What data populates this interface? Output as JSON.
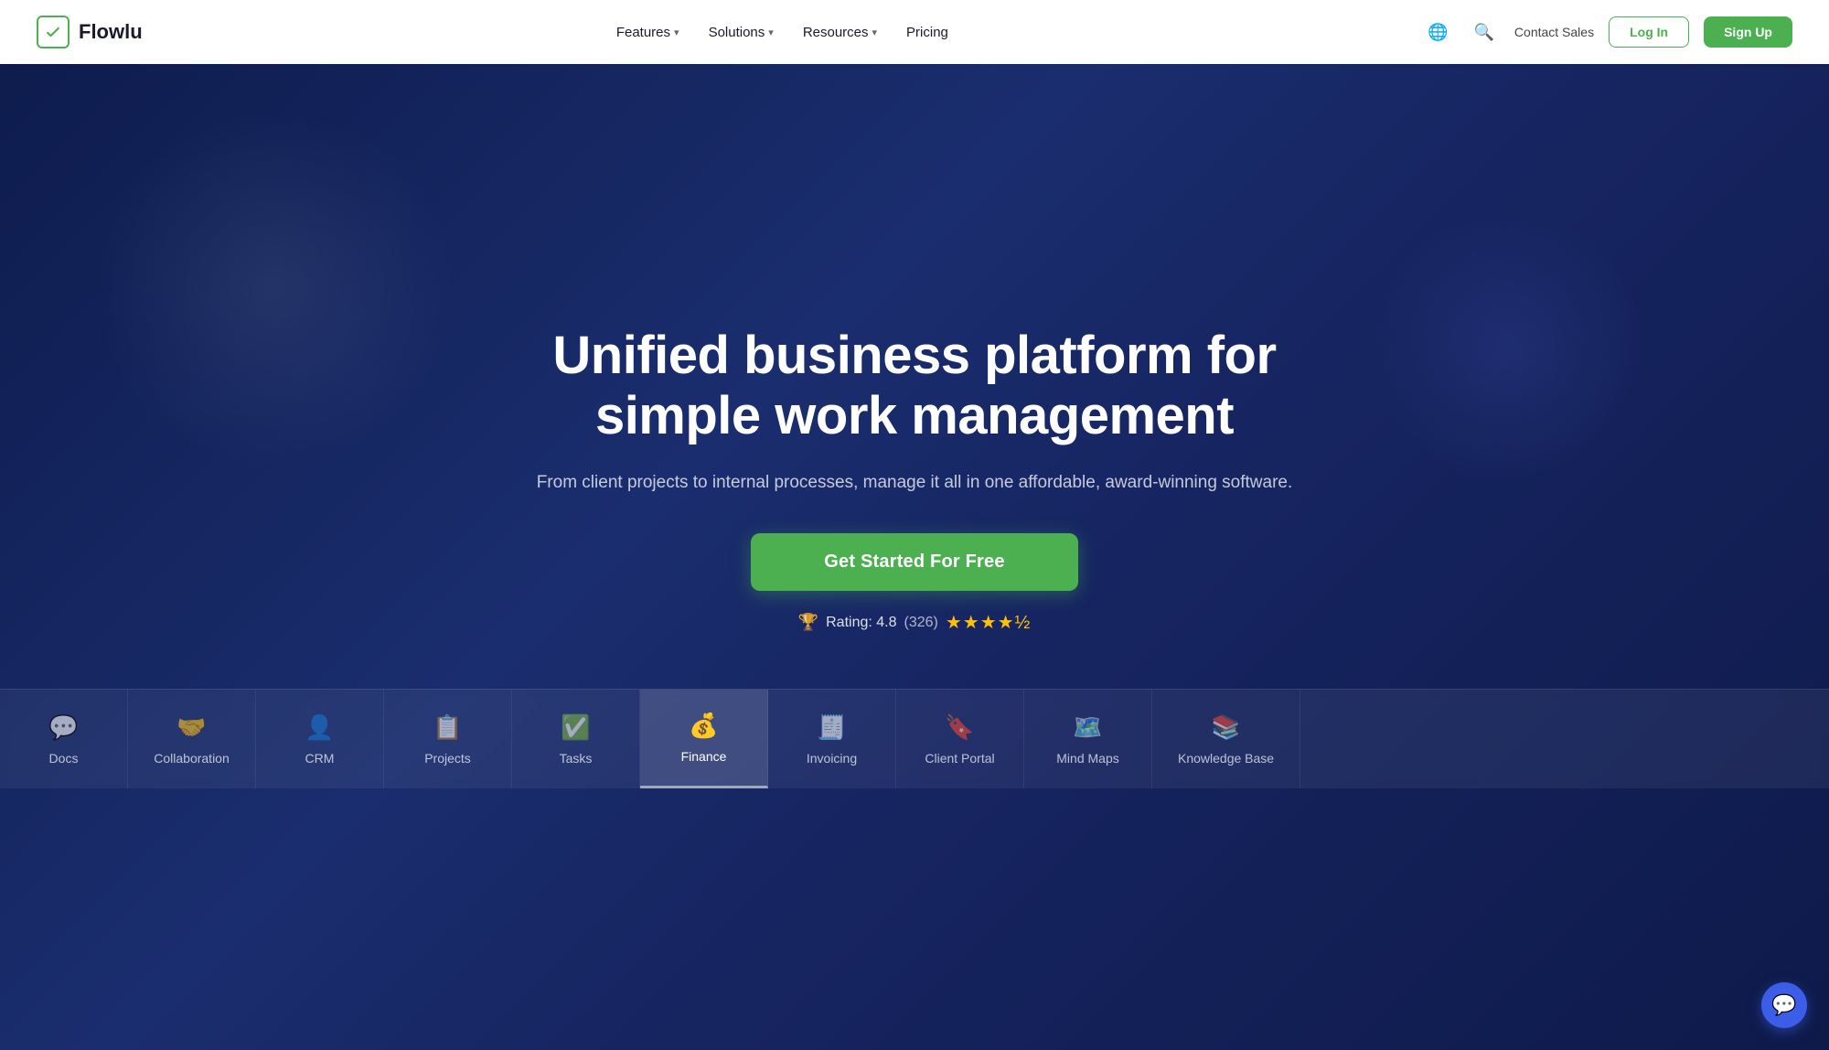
{
  "nav": {
    "logo_text": "Flowlu",
    "links": [
      {
        "label": "Features",
        "has_dropdown": true
      },
      {
        "label": "Solutions",
        "has_dropdown": true
      },
      {
        "label": "Resources",
        "has_dropdown": true
      },
      {
        "label": "Pricing",
        "has_dropdown": false
      }
    ],
    "contact_sales": "Contact Sales",
    "login_label": "Log In",
    "signup_label": "Sign Up"
  },
  "hero": {
    "title": "Unified business platform for simple work management",
    "subtitle": "From client projects to internal processes, manage it all in one affordable, award-winning software.",
    "cta_label": "Get Started For Free",
    "rating_text": "Rating: 4.8",
    "rating_count": "(326)",
    "rating_stars": "★★★★½"
  },
  "feature_tabs": [
    {
      "id": "docs",
      "icon": "💬",
      "label": "Docs"
    },
    {
      "id": "collaboration",
      "icon": "🤝",
      "label": "Collaboration"
    },
    {
      "id": "crm",
      "icon": "👤",
      "label": "CRM"
    },
    {
      "id": "projects",
      "icon": "📋",
      "label": "Projects"
    },
    {
      "id": "tasks",
      "icon": "✅",
      "label": "Tasks"
    },
    {
      "id": "finance",
      "icon": "💰",
      "label": "Finance",
      "active": true
    },
    {
      "id": "invoicing",
      "icon": "🧾",
      "label": "Invoicing"
    },
    {
      "id": "client_portal",
      "icon": "🔖",
      "label": "Client Portal"
    },
    {
      "id": "mind_maps",
      "icon": "🗺️",
      "label": "Mind Maps"
    },
    {
      "id": "knowledge_base",
      "icon": "📚",
      "label": "Knowledge Base"
    }
  ],
  "chat_widget": {
    "icon": "💬"
  }
}
